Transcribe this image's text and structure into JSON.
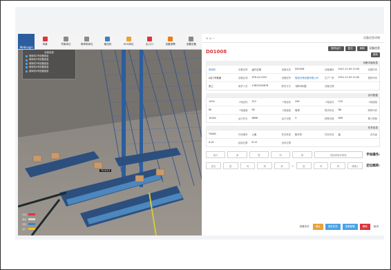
{
  "app": {
    "logo_text": "WebLogis"
  },
  "toolbar": {
    "items": [
      {
        "label": "场景",
        "color": "#d9363e"
      },
      {
        "label": "货架库位",
        "color": "#8a8a8a"
      },
      {
        "label": "堆垛机库位",
        "color": "#8a8a8a"
      },
      {
        "label": "输送线",
        "color": "#3b82c4"
      },
      {
        "label": "AGV库位",
        "color": "#e8a23a"
      },
      {
        "label": "出入口",
        "color": "#d9363e"
      },
      {
        "label": "设备报警",
        "color": "#f07a1a"
      },
      {
        "label": "设置设备",
        "color": "#888888"
      }
    ]
  },
  "scene": {
    "panel_title": "仓库信息",
    "lines": [
      "堆垛机1号设备信息",
      "堆垛机2号设备信息",
      "堆垛机3号设备信息",
      "堆垛机4号设备信息",
      "堆垛机5号设备信息"
    ],
    "label_3d": "TU-013",
    "legend": [
      {
        "label": "在线",
        "color": "#d9363e"
      },
      {
        "label": "离线",
        "color": "#d9d9d9"
      },
      {
        "label": "待机",
        "color": "#3b82c4"
      },
      {
        "label": "运行",
        "color": "#f0c419"
      }
    ]
  },
  "right": {
    "top_left": "✕ ⊙ −",
    "top_right": "设备信息详情",
    "code": "D01008",
    "buttons_row1": [
      "暂停运行",
      "复位",
      "刷新"
    ],
    "side_label": "设备信息",
    "button_row2": "更新",
    "section1_title": "设备详细信息",
    "section1_rows": [
      [
        {
          "label": "设备名称",
          "value": "堆垛机",
          "blue": true
        },
        {
          "label": "设备状态",
          "value": "运行正常"
        },
        {
          "label": "设备编码",
          "value": "D01008"
        },
        {
          "label": "创建时间",
          "value": "2021-11-09 12:00"
        }
      ],
      [
        {
          "label": "设备区域",
          "value": "A区1号巷道"
        },
        {
          "label": "设备型号",
          "value": "STK-LX-2100"
        },
        {
          "label": "生产厂家",
          "value": "智能仓储设备有限公司",
          "blue": true
        },
        {
          "label": "更新时间",
          "value": "2021-11-09 12:00"
        }
      ],
      [
        {
          "label": "维护人员",
          "value": "张工"
        },
        {
          "label": "联系方式",
          "value": "13812345678"
        },
        {
          "label": "设备位置",
          "value": "1排1列1层"
        },
        {
          "label": "",
          "value": ""
        }
      ]
    ],
    "section2_title": "实时数据",
    "section2_rows": [
      [
        {
          "label": "X轴坐标",
          "value": "1024"
        },
        {
          "label": "Y轴坐标",
          "value": "512"
        },
        {
          "label": "Z轴坐标",
          "value": "256"
        },
        {
          "label": "X轴速度",
          "value": "120"
        }
      ],
      [
        {
          "label": "Y轴速度",
          "value": "80"
        },
        {
          "label": "Z轴速度",
          "value": "60"
        },
        {
          "label": "载货状态",
          "value": "有货"
        },
        {
          "label": "故障代码",
          "value": "NA"
        }
      ],
      [
        {
          "label": "运行时长",
          "value": "1024h"
        },
        {
          "label": "运行次数",
          "value": "8896"
        },
        {
          "label": "报警次数",
          "value": "3"
        },
        {
          "label": "累计里程",
          "value": "896"
        }
      ]
    ],
    "section3_title": "任务信息",
    "section3_rows": [
      [
        {
          "label": "任务编号",
          "value": "T0089"
        },
        {
          "label": "任务类型",
          "value": "入库"
        },
        {
          "label": "任务状态",
          "value": "执行中"
        },
        {
          "label": "优先级",
          "value": "高"
        }
      ],
      [
        {
          "label": "起始位置",
          "value": "A-01"
        },
        {
          "label": "目标位置",
          "value": "B-12"
        },
        {
          "label": "",
          "value": ""
        },
        {
          "label": "",
          "value": ""
        }
      ]
    ],
    "filter1_label": "手动操作:",
    "filter1_boxes": [
      "请选择操作类型",
      "排",
      "列",
      "层",
      "深",
      "执行"
    ],
    "filter2_label": "定位跳转:",
    "filter2_boxes": [
      "请输入",
      "排",
      "列",
      "层",
      "深",
      "排",
      "列",
      "层",
      "定位"
    ],
    "actions": [
      {
        "label": "取消",
        "color": ""
      },
      {
        "label": "删除",
        "color": "#d9363e"
      },
      {
        "label": "重置报警",
        "color": "#4ba3e3"
      },
      {
        "label": "清空任务",
        "color": "#4ba3e3"
      },
      {
        "label": "确认",
        "color": "#e8a23a"
      },
      {
        "label": "查看历史",
        "color": ""
      }
    ]
  }
}
